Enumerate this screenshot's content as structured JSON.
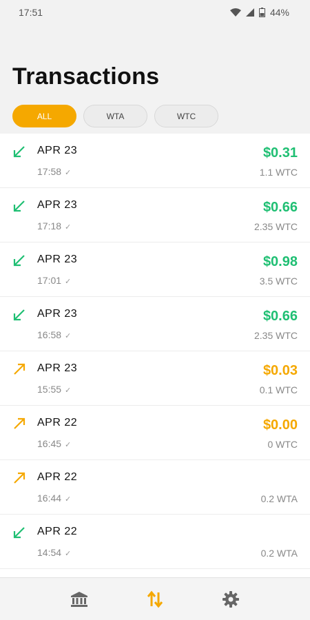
{
  "status_bar": {
    "time": "17:51",
    "battery": "44%"
  },
  "header": {
    "title": "Transactions"
  },
  "filters": [
    {
      "label": "ALL",
      "active": true
    },
    {
      "label": "WTA",
      "active": false
    },
    {
      "label": "WTC",
      "active": false
    }
  ],
  "colors": {
    "incoming": "#1fbf73",
    "outgoing": "#f5a800",
    "accent": "#f5a800"
  },
  "transactions": [
    {
      "direction": "incoming",
      "date": "APR 23",
      "time": "17:58",
      "amount": "$0.31",
      "sub": "1.1 WTC"
    },
    {
      "direction": "incoming",
      "date": "APR 23",
      "time": "17:18",
      "amount": "$0.66",
      "sub": "2.35 WTC"
    },
    {
      "direction": "incoming",
      "date": "APR 23",
      "time": "17:01",
      "amount": "$0.98",
      "sub": "3.5 WTC"
    },
    {
      "direction": "incoming",
      "date": "APR 23",
      "time": "16:58",
      "amount": "$0.66",
      "sub": "2.35 WTC"
    },
    {
      "direction": "outgoing",
      "date": "APR 23",
      "time": "15:55",
      "amount": "$0.03",
      "sub": "0.1 WTC"
    },
    {
      "direction": "outgoing",
      "date": "APR 22",
      "time": "16:45",
      "amount": "$0.00",
      "sub": "0 WTC"
    },
    {
      "direction": "outgoing",
      "date": "APR 22",
      "time": "16:44",
      "amount": "",
      "sub": "0.2 WTA"
    },
    {
      "direction": "incoming",
      "date": "APR 22",
      "time": "14:54",
      "amount": "",
      "sub": "0.2 WTA"
    }
  ],
  "bottom_nav": [
    {
      "icon": "bank-icon",
      "active": false
    },
    {
      "icon": "transfer-arrows-icon",
      "active": true
    },
    {
      "icon": "gear-icon",
      "active": false
    }
  ]
}
